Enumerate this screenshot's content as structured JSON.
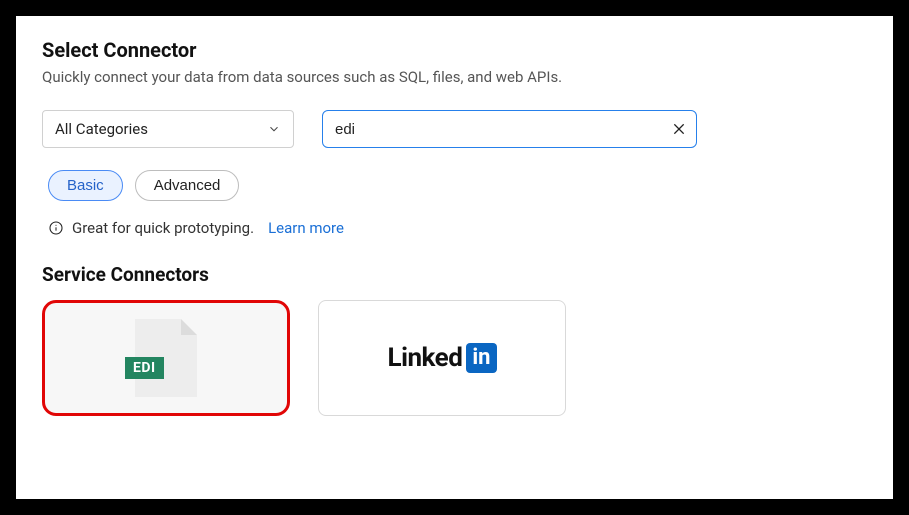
{
  "header": {
    "title": "Select Connector",
    "subtitle": "Quickly connect your data from data sources such as SQL, files, and web APIs."
  },
  "controls": {
    "category_dropdown": {
      "selected": "All Categories"
    },
    "search": {
      "value": "edi",
      "placeholder": ""
    }
  },
  "mode_pills": {
    "basic": "Basic",
    "advanced": "Advanced",
    "active": "basic"
  },
  "info": {
    "text": "Great for quick prototyping.",
    "learn_more": "Learn more"
  },
  "section": {
    "heading": "Service Connectors"
  },
  "connectors": {
    "edi": {
      "badge": "EDI"
    },
    "linkedin": {
      "text": "Linked",
      "in": "in"
    }
  }
}
